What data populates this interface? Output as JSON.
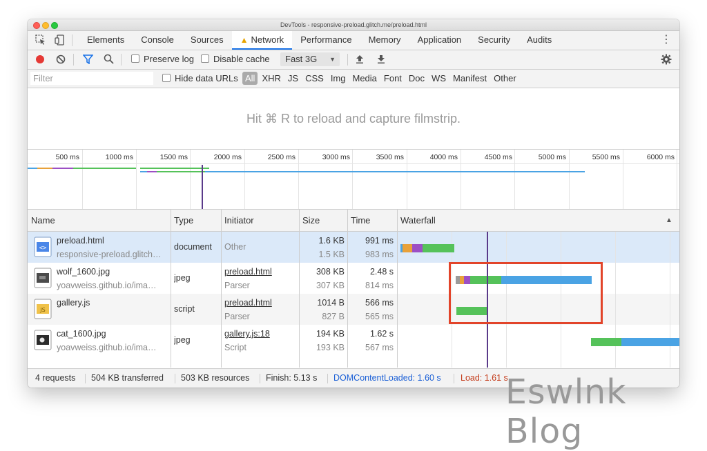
{
  "window": {
    "title": "DevTools - responsive-preload.glitch.me/preload.html"
  },
  "tabs": [
    {
      "label": "Elements"
    },
    {
      "label": "Console"
    },
    {
      "label": "Sources"
    },
    {
      "label": "Network",
      "active": true
    },
    {
      "label": "Performance"
    },
    {
      "label": "Memory"
    },
    {
      "label": "Application"
    },
    {
      "label": "Security"
    },
    {
      "label": "Audits"
    }
  ],
  "toolbar": {
    "preserve_log": "Preserve log",
    "disable_cache": "Disable cache",
    "throttle": "Fast 3G"
  },
  "filter": {
    "placeholder": "Filter",
    "hide_data_urls": "Hide data URLs",
    "types": [
      "All",
      "XHR",
      "JS",
      "CSS",
      "Img",
      "Media",
      "Font",
      "Doc",
      "WS",
      "Manifest",
      "Other"
    ]
  },
  "filmstrip": {
    "message": "Hit ⌘ R to reload and capture filmstrip."
  },
  "overview": {
    "ticks": [
      "500 ms",
      "1000 ms",
      "1500 ms",
      "2000 ms",
      "2500 ms",
      "3000 ms",
      "3500 ms",
      "4000 ms",
      "4500 ms",
      "5000 ms",
      "5500 ms",
      "6000 ms"
    ]
  },
  "table": {
    "headers": {
      "name": "Name",
      "type": "Type",
      "initiator": "Initiator",
      "size": "Size",
      "time": "Time",
      "waterfall": "Waterfall"
    },
    "rows": [
      {
        "name": "preload.html",
        "url": "responsive-preload.glitch…",
        "type": "document",
        "initiator": "Other",
        "initiator_sub": "",
        "size": "1.6 KB",
        "size_sub": "1.5 KB",
        "time": "991 ms",
        "time_sub": "983 ms"
      },
      {
        "name": "wolf_1600.jpg",
        "url": "yoavweiss.github.io/ima…",
        "type": "jpeg",
        "initiator": "preload.html",
        "initiator_sub": "Parser",
        "size": "308 KB",
        "size_sub": "307 KB",
        "time": "2.48 s",
        "time_sub": "814 ms"
      },
      {
        "name": "gallery.js",
        "url": "",
        "type": "script",
        "initiator": "preload.html",
        "initiator_sub": "Parser",
        "size": "1014 B",
        "size_sub": "827 B",
        "time": "566 ms",
        "time_sub": "565 ms"
      },
      {
        "name": "cat_1600.jpg",
        "url": "yoavweiss.github.io/ima…",
        "type": "jpeg",
        "initiator": "gallery.js:18",
        "initiator_sub": "Script",
        "size": "194 KB",
        "size_sub": "193 KB",
        "time": "1.62 s",
        "time_sub": "567 ms"
      }
    ]
  },
  "status": {
    "requests": "4 requests",
    "transferred": "504 KB transferred",
    "resources": "503 KB resources",
    "finish": "Finish: 5.13 s",
    "dcl": "DOMContentLoaded: 1.60 s",
    "load": "Load: 1.61 s"
  },
  "colors": {
    "dcl": "#1a5fd6",
    "load": "#c43b1a",
    "receive": "#4aa3e4",
    "waiting": "#55c25a",
    "highlight": "#e2442a"
  },
  "watermark": "Eswlnk Blog"
}
